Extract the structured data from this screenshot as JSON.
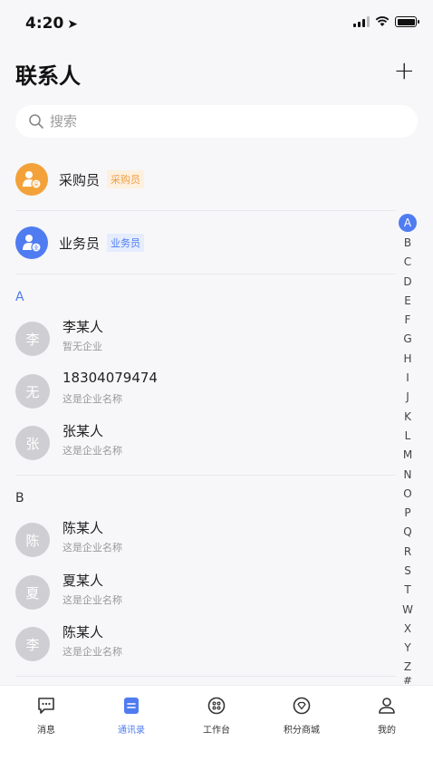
{
  "status_bar": {
    "time": "4:20"
  },
  "header": {
    "title": "联系人",
    "add_label": "+"
  },
  "search": {
    "placeholder": "搜索"
  },
  "roles": [
    {
      "name": "采购员",
      "tag": "采购员",
      "color": "#f3a23a",
      "tag_bg": "#fdf0df",
      "tag_color": "#f0a04a"
    },
    {
      "name": "业务员",
      "tag": "业务员",
      "color": "#4f7cf0",
      "tag_bg": "#e4ecfd",
      "tag_color": "#4f7cf0"
    }
  ],
  "sections": [
    {
      "letter": "A",
      "contacts": [
        {
          "avatar": "李",
          "name": "李某人",
          "company": "暂无企业"
        },
        {
          "avatar": "无",
          "name": "18304079474",
          "company": "这是企业名称"
        },
        {
          "avatar": "张",
          "name": "张某人",
          "company": "这是企业名称"
        }
      ]
    },
    {
      "letter": "B",
      "contacts": [
        {
          "avatar": "陈",
          "name": "陈某人",
          "company": "这是企业名称"
        },
        {
          "avatar": "夏",
          "name": "夏某人",
          "company": "这是企业名称"
        },
        {
          "avatar": "李",
          "name": "陈某人",
          "company": "这是企业名称"
        }
      ]
    }
  ],
  "index_bar": {
    "letters": [
      "A",
      "B",
      "C",
      "D",
      "E",
      "F",
      "G",
      "H",
      "I",
      "J",
      "K",
      "L",
      "M",
      "N",
      "O",
      "P",
      "Q",
      "R",
      "S",
      "T",
      "W",
      "X",
      "Y",
      "Z",
      "#"
    ],
    "active": "A",
    "accent": "#4f7cf0"
  },
  "tabs": [
    {
      "label": "消息",
      "icon": "message-icon",
      "active": false
    },
    {
      "label": "通讯录",
      "icon": "contacts-icon",
      "active": true
    },
    {
      "label": "工作台",
      "icon": "workbench-icon",
      "active": false
    },
    {
      "label": "积分商城",
      "icon": "points-mall-icon",
      "active": false
    },
    {
      "label": "我的",
      "icon": "profile-icon",
      "active": false
    }
  ],
  "colors": {
    "accent": "#4f7cf0",
    "section_letter_a": "#4f7cf0",
    "section_letter_b": "#333333"
  }
}
